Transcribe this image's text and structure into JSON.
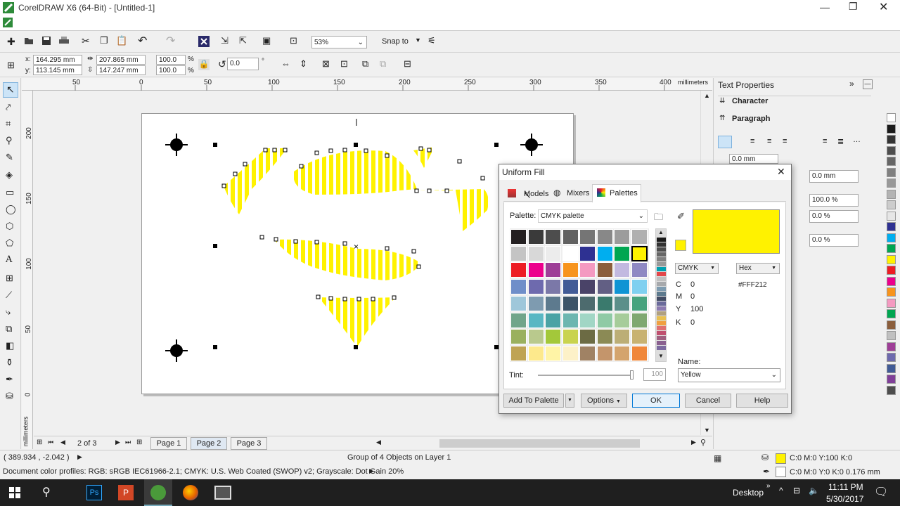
{
  "window": {
    "title": "CorelDRAW X6 (64-Bit) - [Untitled-1]"
  },
  "toolbar": {
    "zoom": "53%",
    "snap": "Snap to"
  },
  "propbar": {
    "x": "164.295 mm",
    "y": "113.145 mm",
    "w": "207.865 mm",
    "h": "147.247 mm",
    "sx": "100.0",
    "sy": "100.0",
    "pct": "%",
    "angle": "0.0",
    "deg": "°"
  },
  "ruler": {
    "unit": "millimeters",
    "top_ticks": [
      "50",
      "0",
      "50",
      "100",
      "150",
      "200",
      "250",
      "300",
      "350",
      "400"
    ],
    "left_ticks": [
      "200",
      "150",
      "100",
      "50",
      "0"
    ]
  },
  "docker": {
    "title": "Text Properties",
    "character": "Character",
    "paragraph": "Paragraph",
    "fields": [
      "0.0 mm",
      "0.0 mm",
      "100.0 %",
      "0.0 %",
      "0.0 %"
    ]
  },
  "dialog": {
    "title": "Uniform Fill",
    "tabs": [
      "Models",
      "Mixers",
      "Palettes"
    ],
    "palette_label": "Palette:",
    "palette_value": "CMYK palette",
    "model": "CMYK",
    "hex_mode": "Hex",
    "hex_value": "#FFF212",
    "cmyk": [
      {
        "k": "C",
        "v": "0"
      },
      {
        "k": "M",
        "v": "0"
      },
      {
        "k": "Y",
        "v": "100"
      },
      {
        "k": "K",
        "v": "0"
      }
    ],
    "tint_label": "Tint:",
    "tint_value": "100",
    "name_label": "Name:",
    "name_value": "Yellow",
    "buttons": {
      "add": "Add To Palette",
      "options": "Options",
      "ok": "OK",
      "cancel": "Cancel",
      "help": "Help"
    },
    "swatches": [
      "#231f20",
      "#3a3a3a",
      "#4d4d4d",
      "#616161",
      "#757575",
      "#888888",
      "#9c9c9c",
      "#b0b0b0",
      "#c4c4c4",
      "#d8d8d8",
      "#ececec",
      "#ffffff",
      "#2e3192",
      "#00aeef",
      "#00a651",
      "#fff200",
      "#ed1c24",
      "#ec008c",
      "#9e3e97",
      "#f7941d",
      "#f49ac1",
      "#8b5e3c",
      "#c2b9e0",
      "#8f89c3",
      "#6f8ec9",
      "#6e6aae",
      "#7b78a8",
      "#415b96",
      "#4a4368",
      "#625f84",
      "#0f94d4",
      "#7fd0f0",
      "#9fc7da",
      "#7e9bb0",
      "#5d7a8e",
      "#3c5468",
      "#4d6b6e",
      "#3a7a6d",
      "#5b8f8a",
      "#47a37e",
      "#70a58a",
      "#59b7c3",
      "#4aa3a5",
      "#6cb6b0",
      "#a1d6c5",
      "#8fcaa5",
      "#a6cc9a",
      "#7fa871",
      "#9ab05e",
      "#b9c98d",
      "#a3c83a",
      "#c9d34f",
      "#6c6b44",
      "#8b8a55",
      "#bcae76",
      "#c8b271",
      "#bfa353",
      "#fde98c",
      "#fff4a6",
      "#fdf1c8",
      "#a08264",
      "#c4956b",
      "#d4a46d",
      "#f0873a",
      "#f7a440"
    ],
    "strip": [
      "#1a1a1a",
      "#333",
      "#4d4d4d",
      "#666",
      "#808080",
      "#999",
      "#00a0b0",
      "#e3484b",
      "#c0c0c0",
      "#a7a9ac",
      "#7e9bb0",
      "#5d7a8e",
      "#414b63",
      "#6a6a9a",
      "#8c7bb0",
      "#b0a080",
      "#e8c050",
      "#f0a040",
      "#e07070",
      "#c05070",
      "#a06080",
      "#8a6090",
      "#7c6aa0"
    ]
  },
  "canvas": {
    "page_tabs": [
      "Page 1",
      "Page 2",
      "Page 3"
    ],
    "page_counter": "2 of 3"
  },
  "status": {
    "coords": "( 389.934 , -2.042 )",
    "selection": "Group of 4 Objects on Layer 1",
    "profiles": "Document color profiles: RGB: sRGB IEC61966-2.1; CMYK: U.S. Web Coated (SWOP) v2; Grayscale: Dot Gain 20%",
    "fill_info": "C:0 M:0 Y:100 K:0",
    "outline_info": "C:0 M:0 Y:0 K:0  0.176 mm"
  },
  "taskbar": {
    "desktop": "Desktop",
    "time": "11:11 PM",
    "date": "5/30/2017"
  },
  "right_palette": [
    "#ffffff",
    "#1a1a1a",
    "#333333",
    "#4d4d4d",
    "#666666",
    "#808080",
    "#999999",
    "#b3b3b3",
    "#cccccc",
    "#e6e6e6",
    "#2e3192",
    "#00aeef",
    "#00a651",
    "#fff200",
    "#ed1c24",
    "#ec008c",
    "#f7941d",
    "#f49ac1",
    "#00a651",
    "#8b5e3c",
    "#c0c0c0",
    "#9e3e97",
    "#6e6aae",
    "#415b96",
    "#7f3f98",
    "#4d4d4d"
  ],
  "colors": {
    "accent": "#fff200",
    "select_blue": "#cce4f7",
    "dialog_border": "#6d6d6d"
  }
}
